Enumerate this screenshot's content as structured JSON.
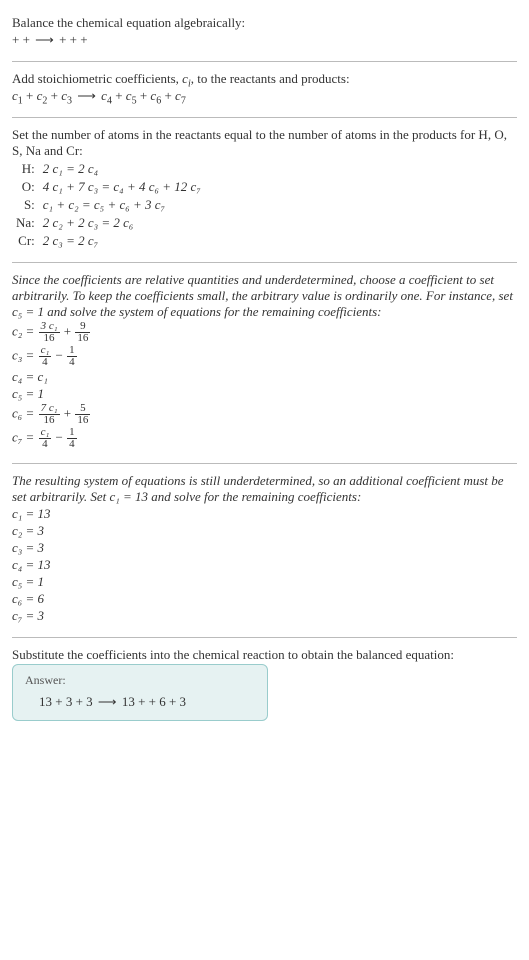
{
  "s1": {
    "t1": "Balance the chemical equation algebraically:",
    "t2_l": " +  + ",
    "t2_arrow": "⟶",
    "t2_r": " +  +  + "
  },
  "s2": {
    "t1_a": "Add stoichiometric coefficients, ",
    "t1_b": "c",
    "t1_c": "i",
    "t1_d": ", to the reactants and products:",
    "c1": "c",
    "n1": "1",
    "c2": "c",
    "n2": "2",
    "c3": "c",
    "n3": "3",
    "c4": "c",
    "n4": "4",
    "c5": "c",
    "n5": "5",
    "c6": "c",
    "n6": "6",
    "c7": "c",
    "n7": "7",
    "arrow": "⟶"
  },
  "s3": {
    "intro": "Set the number of atoms in the reactants equal to the number of atoms in the products for H, O, S, Na and Cr:",
    "rows": {
      "h_l": "H:",
      "h_r": "2 c₁ = 2 c₄",
      "o_l": "O:",
      "o_r": "4 c₁ + 7 c₃ = c₄ + 4 c₆ + 12 c₇",
      "s_l": "S:",
      "s_r": "c₁ + c₂ = c₅ + c₆ + 3 c₇",
      "na_l": "Na:",
      "na_r": "2 c₂ + 2 c₃ = 2 c₆",
      "cr_l": "Cr:",
      "cr_r": "2 c₃ = 2 c₇"
    }
  },
  "s4": {
    "intro": "Since the coefficients are relative quantities and underdetermined, choose a coefficient to set arbitrarily. To keep the coefficients small, the arbitrary value is ordinarily one. For instance, set c₅ = 1 and solve the system of equations for the remaining coefficients:",
    "eq": {
      "c2l": "c₂ = ",
      "c2f1n": "3 c₁",
      "c2f1d": "16",
      "c2p": " + ",
      "c2f2n": "9",
      "c2f2d": "16",
      "c3l": "c₃ = ",
      "c3f1n": "c₁",
      "c3f1d": "4",
      "c3m": " − ",
      "c3f2n": "1",
      "c3f2d": "4",
      "c4": "c₄ = c₁",
      "c5": "c₅ = 1",
      "c6l": "c₆ = ",
      "c6f1n": "7 c₁",
      "c6f1d": "16",
      "c6p": " + ",
      "c6f2n": "5",
      "c6f2d": "16",
      "c7l": "c₇ = ",
      "c7f1n": "c₁",
      "c7f1d": "4",
      "c7m": " − ",
      "c7f2n": "1",
      "c7f2d": "4"
    }
  },
  "s5": {
    "intro": "The resulting system of equations is still underdetermined, so an additional coefficient must be set arbitrarily. Set c₁ = 13 and solve for the remaining coefficients:",
    "lines": {
      "l1": "c₁ = 13",
      "l2": "c₂ = 3",
      "l3": "c₃ = 3",
      "l4": "c₄ = 13",
      "l5": "c₅ = 1",
      "l6": "c₆ = 6",
      "l7": "c₇ = 3"
    }
  },
  "s6": {
    "intro": "Substitute the coefficients into the chemical reaction to obtain the balanced equation:",
    "answer_label": "Answer:",
    "answer_l": "13  + 3  + 3 ",
    "answer_arrow": "⟶",
    "answer_r": " 13  +  + 6  + 3 "
  }
}
